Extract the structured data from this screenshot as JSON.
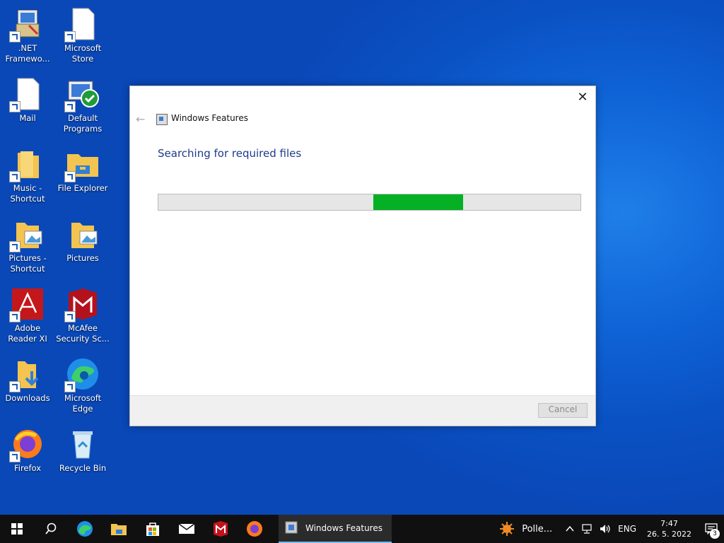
{
  "desktop_icons": [
    {
      "label": ".NET Framewo...",
      "icon": "installer-icon"
    },
    {
      "label": "Microsoft Store",
      "icon": "document-icon"
    },
    {
      "label": "Mail",
      "icon": "document-icon"
    },
    {
      "label": "Default Programs",
      "icon": "default-programs-icon"
    },
    {
      "label": "Music - Shortcut",
      "icon": "folder-icon"
    },
    {
      "label": "File Explorer",
      "icon": "file-explorer-icon"
    },
    {
      "label": "Pictures - Shortcut",
      "icon": "pictures-folder-icon"
    },
    {
      "label": "Pictures",
      "icon": "pictures-folder-icon"
    },
    {
      "label": "Adobe Reader XI",
      "icon": "adobe-reader-icon"
    },
    {
      "label": "McAfee Security Sc...",
      "icon": "mcafee-icon"
    },
    {
      "label": "Downloads",
      "icon": "downloads-folder-icon"
    },
    {
      "label": "Microsoft Edge",
      "icon": "edge-icon"
    },
    {
      "label": "Firefox",
      "icon": "firefox-icon"
    },
    {
      "label": "Recycle Bin",
      "icon": "recycle-bin-icon"
    }
  ],
  "dialog": {
    "title": "Windows Features",
    "status": "Searching for required files",
    "cancel_label": "Cancel",
    "close_glyph": "✕",
    "back_glyph": "←"
  },
  "taskbar": {
    "active_window": "Windows Features",
    "weather": "Polle...",
    "language": "ENG",
    "time": "7:47",
    "date": "26. 5. 2022",
    "notification_count": "3"
  },
  "colors": {
    "progress": "#06b025",
    "desktop": "#0a52c4",
    "status_text": "#1e3a8a"
  }
}
